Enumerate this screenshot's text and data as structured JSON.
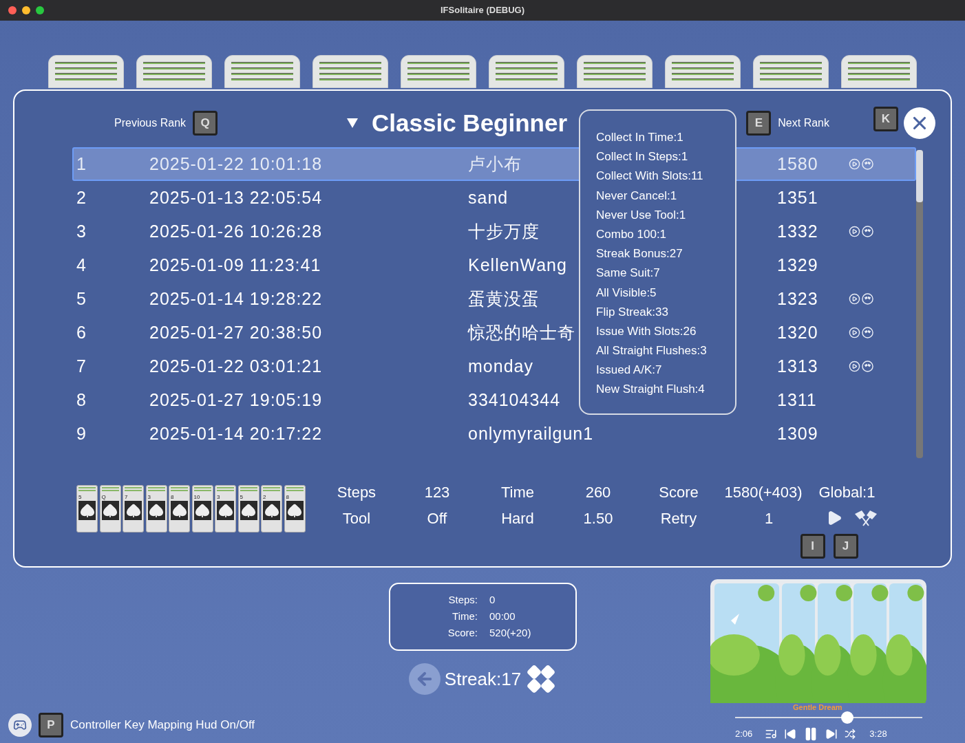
{
  "window": {
    "title": "IFSolitaire (DEBUG)"
  },
  "header": {
    "previous_rank": "Previous Rank",
    "previous_key": "Q",
    "title": "Classic Beginner",
    "next_key": "E",
    "next_rank": "Next Rank",
    "close_key": "K"
  },
  "rows": [
    {
      "rank": "1",
      "date": "2025-01-22 10:01:18",
      "name": "卢小布",
      "score": "1580",
      "has_replay": true,
      "selected": true
    },
    {
      "rank": "2",
      "date": "2025-01-13 22:05:54",
      "name": "sand",
      "score": "1351",
      "has_replay": false,
      "selected": false
    },
    {
      "rank": "3",
      "date": "2025-01-26 10:26:28",
      "name": "十步万度",
      "score": "1332",
      "has_replay": true,
      "selected": false
    },
    {
      "rank": "4",
      "date": "2025-01-09 11:23:41",
      "name": "KellenWang",
      "score": "1329",
      "has_replay": false,
      "selected": false
    },
    {
      "rank": "5",
      "date": "2025-01-14 19:28:22",
      "name": "蛋黄没蛋",
      "score": "1323",
      "has_replay": true,
      "selected": false
    },
    {
      "rank": "6",
      "date": "2025-01-27 20:38:50",
      "name": "惊恐的哈士奇",
      "score": "1320",
      "has_replay": true,
      "selected": false
    },
    {
      "rank": "7",
      "date": "2025-01-22 03:01:21",
      "name": "monday",
      "score": "1313",
      "has_replay": true,
      "selected": false
    },
    {
      "rank": "8",
      "date": "2025-01-27 19:05:19",
      "name": "334104344",
      "score": "1311",
      "has_replay": false,
      "selected": false
    },
    {
      "rank": "9",
      "date": "2025-01-14 20:17:22",
      "name": "onlymyrailgun1",
      "score": "1309",
      "has_replay": false,
      "selected": false
    }
  ],
  "tooltip": [
    "Collect In Time:1",
    "Collect In Steps:1",
    "Collect With Slots:11",
    "Never Cancel:1",
    "Never Use Tool:1",
    "Combo 100:1",
    "Streak Bonus:27",
    "Same Suit:7",
    "All Visible:5",
    "Flip Streak:33",
    "Issue With Slots:26",
    "All Straight Flushes:3",
    "Issued A/K:7",
    "New Straight Flush:4"
  ],
  "hand": [
    "5",
    "Q",
    "7",
    "3",
    "8",
    "10",
    "3",
    "5",
    "2",
    "8"
  ],
  "stats": [
    [
      "Steps",
      "123",
      "Time",
      "260",
      "Score",
      "1580(+403)",
      "Global:1"
    ],
    [
      "Tool",
      "Off",
      "Hard",
      "1.50",
      "Retry",
      "1"
    ]
  ],
  "action_keys": [
    "I",
    "J"
  ],
  "hud": [
    {
      "label": "Steps:",
      "value": "0"
    },
    {
      "label": "Time:",
      "value": "00:00"
    },
    {
      "label": "Score:",
      "value": "520(+20)"
    }
  ],
  "streak": "Streak:17",
  "footer": {
    "key": "P",
    "text": "Controller Key Mapping Hud On/Off"
  },
  "music": {
    "title": "Gentle Dream",
    "elapsed": "2:06",
    "total": "3:28",
    "level": 0.6
  }
}
